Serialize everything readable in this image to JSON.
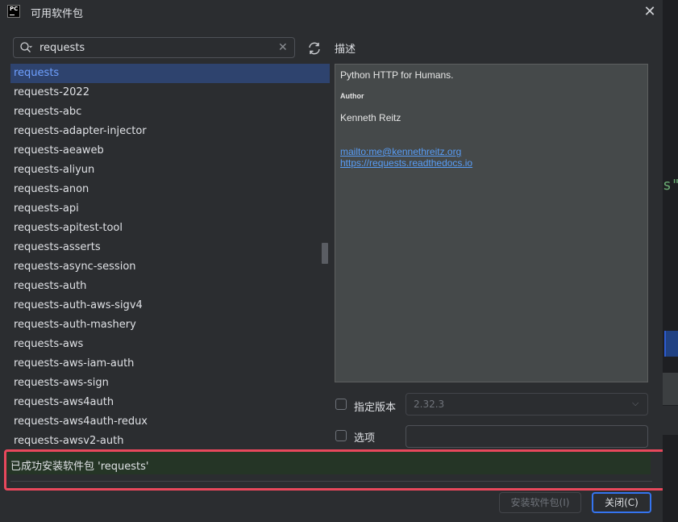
{
  "window": {
    "title": "可用软件包",
    "app_icon_text": "PC"
  },
  "search": {
    "value": "requests",
    "placeholder": ""
  },
  "packages": [
    "requests",
    "requests-2022",
    "requests-abc",
    "requests-adapter-injector",
    "requests-aeaweb",
    "requests-aliyun",
    "requests-anon",
    "requests-api",
    "requests-apitest-tool",
    "requests-asserts",
    "requests-async-session",
    "requests-auth",
    "requests-auth-aws-sigv4",
    "requests-auth-mashery",
    "requests-aws",
    "requests-aws-iam-auth",
    "requests-aws-sign",
    "requests-aws4auth",
    "requests-aws4auth-redux",
    "requests-awsv2-auth"
  ],
  "selected_package": "requests",
  "description": {
    "label": "描述",
    "summary": "Python HTTP for Humans.",
    "author_heading": "Author",
    "author": "Kenneth Reitz",
    "link_email": "mailto:me@kennethreitz.org",
    "link_docs": "https://requests.readthedocs.io"
  },
  "version": {
    "label": "指定版本",
    "value": "2.32.3",
    "checked": false
  },
  "options": {
    "label": "选项",
    "value": "",
    "checked": false
  },
  "status": {
    "message": "已成功安装软件包 'requests'"
  },
  "buttons": {
    "install": "安装软件包(I)",
    "close": "关闭(C)"
  },
  "background_editor": {
    "code_fragment": "s\""
  },
  "colors": {
    "background": "#2b2d30",
    "selection": "#2e436e",
    "success_bar": "#253526",
    "highlight_border": "#e8485c",
    "accent": "#3574f0",
    "link": "#589df6"
  }
}
